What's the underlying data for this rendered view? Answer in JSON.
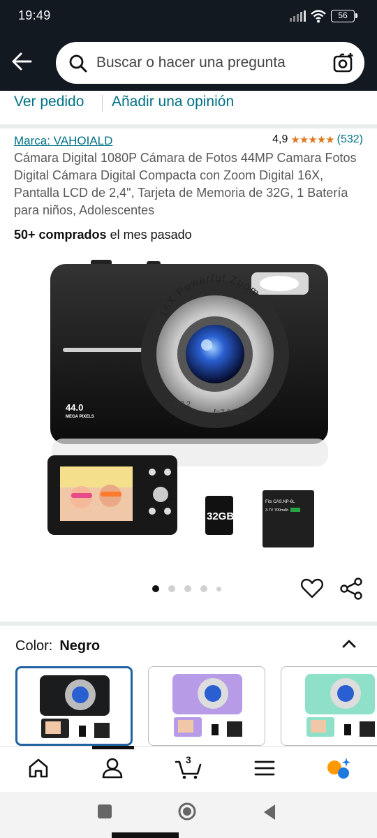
{
  "status": {
    "time": "19:49",
    "battery": "56"
  },
  "search": {
    "placeholder": "Buscar o hacer una pregunta"
  },
  "actions": {
    "view_order": "Ver pedido",
    "add_review": "Añadir una opinión"
  },
  "product": {
    "brand": "Marca: VAHOIALD",
    "rating": "4,9",
    "stars": "★★★★★",
    "reviews": "(532)",
    "title": "Cámara Digital 1080P Cámara de Fotos 44MP Camara Fotos Digital Cámara Digital Compacta con Zoom Digital 16X, Pantalla LCD de 2,4\", Tarjeta de Memoria de 32G, 1 Batería para niños, Adolescentes",
    "bought_bold": "50+ comprados",
    "bought_rest": " el mes pasado"
  },
  "image_text": {
    "zoom": "16X Powerful Zoom",
    "mp": "44.0",
    "mp_label": "MEGA PIXELS",
    "aperture": "F/3.2",
    "focal": "f=7.36mm",
    "card": "32GB",
    "battery_model": "Fits CAS.NP-6L",
    "battery_spec": "3.7V 700mAh"
  },
  "gallery": {
    "total_dots": 5,
    "active_dot": 0
  },
  "color": {
    "label": "Color:",
    "value": "Negro"
  },
  "swatches": [
    {
      "name": "black",
      "body": "#1b1c1e",
      "selected": true
    },
    {
      "name": "purple",
      "body": "#b79be6",
      "selected": false
    },
    {
      "name": "mint",
      "body": "#8fe0c8",
      "selected": false
    }
  ],
  "bottom_nav": {
    "cart_count": "3"
  },
  "colors": {
    "header": "#131921",
    "link": "#007185",
    "star": "#de7921",
    "selected": "#2162a1"
  }
}
